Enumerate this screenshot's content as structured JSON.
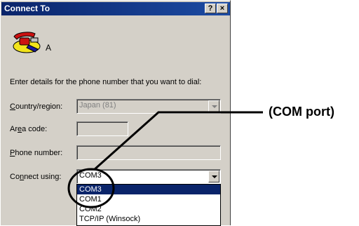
{
  "window": {
    "title": "Connect To",
    "help_button": "?",
    "close_button": "×"
  },
  "connection": {
    "name": "A",
    "icon": "phone-icon"
  },
  "instructions": "Enter details for the phone number that you want to dial:",
  "fields": {
    "country": {
      "label_pre": "",
      "label_key": "C",
      "label_post": "ountry/region:",
      "value": "Japan (81)",
      "enabled": false
    },
    "area_code": {
      "label_pre": "Ar",
      "label_key": "e",
      "label_post": "a code:",
      "value": "",
      "enabled": false
    },
    "phone": {
      "label_pre": "",
      "label_key": "P",
      "label_post": "hone number:",
      "value": "",
      "enabled": false
    },
    "connect_using": {
      "label_pre": "Co",
      "label_key": "n",
      "label_post": "nect using:",
      "value": "COM3",
      "enabled": true
    }
  },
  "dropdown_options": [
    {
      "label": "COM3",
      "selected": true
    },
    {
      "label": "COM1",
      "selected": false
    },
    {
      "label": "COM2",
      "selected": false
    },
    {
      "label": "TCP/IP (Winsock)",
      "selected": false
    }
  ],
  "annotation": {
    "label": "(COM port)"
  },
  "colors": {
    "titlebar": "#0a246a",
    "selection": "#0a246a",
    "dialog_bg": "#d4d0c8"
  }
}
